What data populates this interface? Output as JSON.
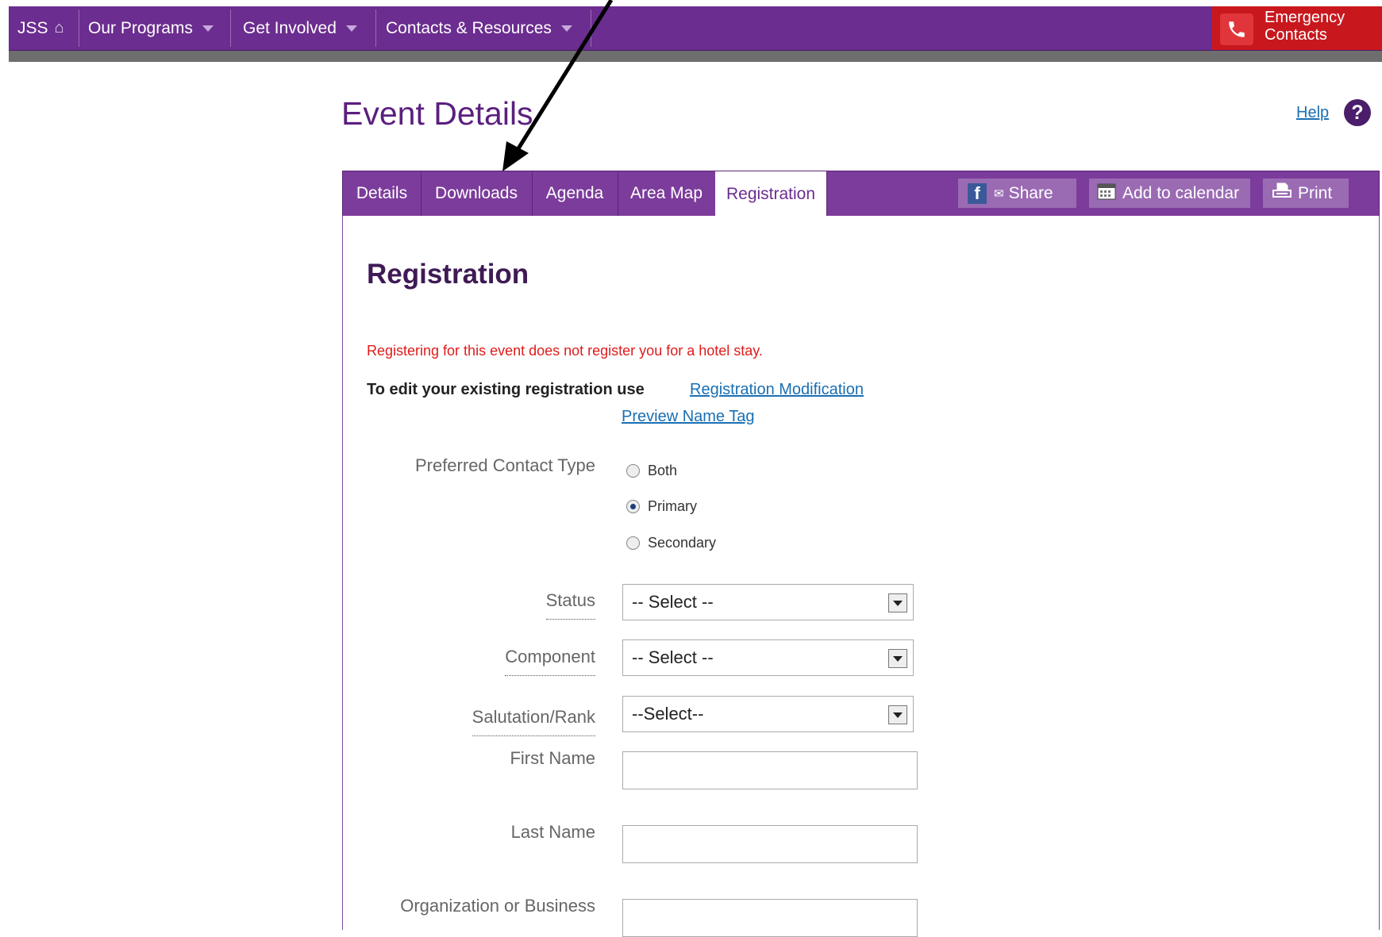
{
  "topnav": {
    "home_label": "JSS",
    "items": [
      {
        "label": "Our Programs"
      },
      {
        "label": "Get Involved"
      },
      {
        "label": "Contacts & Resources"
      }
    ],
    "emergency_label": "Emergency Contacts"
  },
  "page": {
    "title": "Event Details",
    "help_label": "Help",
    "help_icon": "?"
  },
  "tabs": {
    "items": [
      {
        "label": "Details"
      },
      {
        "label": "Downloads"
      },
      {
        "label": "Agenda"
      },
      {
        "label": "Area Map"
      },
      {
        "label": "Registration",
        "active": true
      }
    ],
    "share_label": "Share",
    "fb_icon": "f",
    "calendar_label": "Add to calendar",
    "print_label": "Print"
  },
  "registration": {
    "title": "Registration",
    "notice": "Registering for this event does not register you for a hotel stay.",
    "edit_text": "To edit your existing registration use",
    "modify_link": "Registration Modification",
    "preview_link": "Preview Name Tag",
    "contact_type_label": "Preferred Contact Type",
    "contact_options": [
      {
        "label": "Both",
        "checked": false
      },
      {
        "label": "Primary",
        "checked": true
      },
      {
        "label": "Secondary",
        "checked": false
      }
    ],
    "status_label": "Status",
    "status_value": "-- Select --",
    "component_label": "Component",
    "component_value": "-- Select --",
    "salutation_label": "Salutation/Rank",
    "salutation_value": "--Select--",
    "first_name_label": "First Name",
    "first_name_value": "",
    "last_name_label": "Last Name",
    "last_name_value": "",
    "org_label": "Organization or Business",
    "org_value": ""
  },
  "colors": {
    "nav_purple": "#6b2d8f",
    "emergency_red": "#c8181e",
    "notice_red": "#e01b1b",
    "link_blue": "#1a6fb3"
  }
}
